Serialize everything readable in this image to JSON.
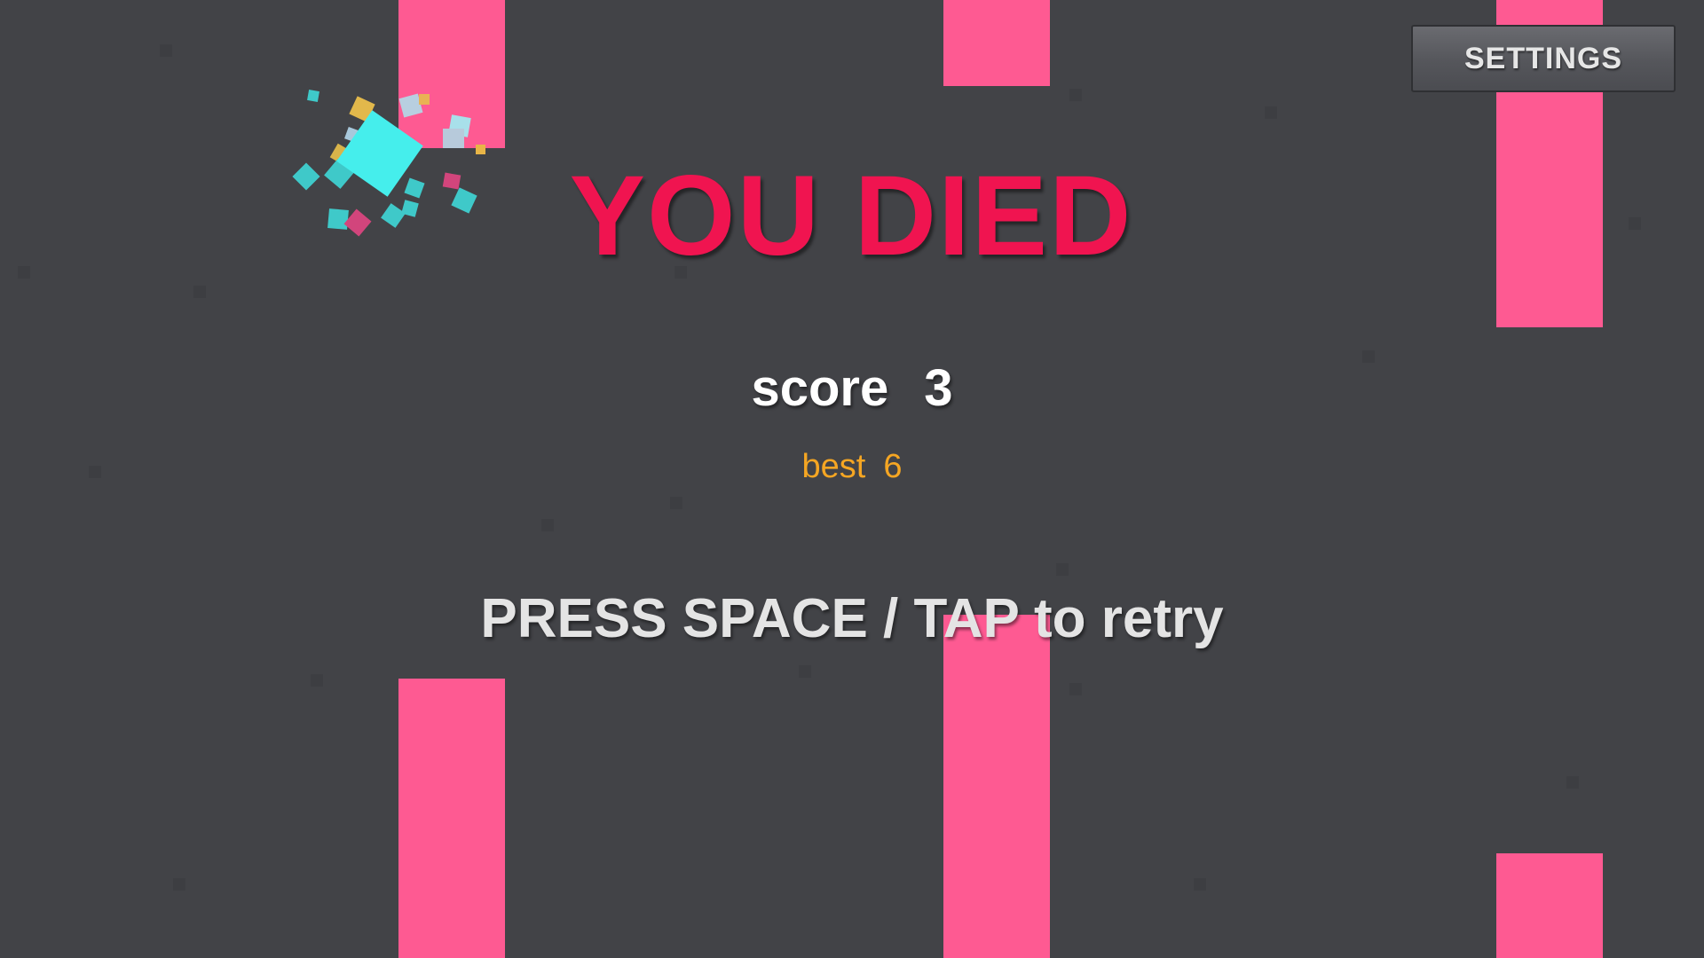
{
  "game": {
    "state_title": "YOU DIED",
    "score_label": "score",
    "score_value": "3",
    "best_label": "best",
    "best_value": "6",
    "retry_prompt": "PRESS SPACE / TAP to retry"
  },
  "settings_button": {
    "label": "SETTINGS"
  },
  "colors": {
    "background": "#424347",
    "pipe": "#fe5a92",
    "title": "#f01450",
    "best_text": "#f5a623",
    "player": "#45eeec"
  }
}
